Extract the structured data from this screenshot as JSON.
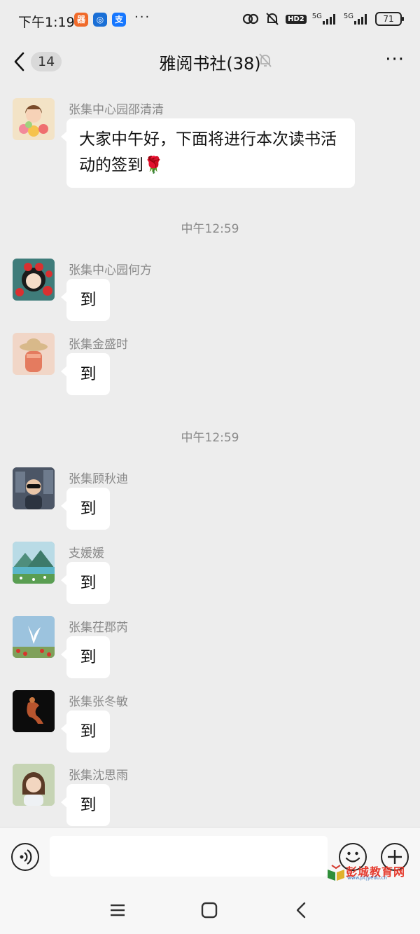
{
  "status_bar": {
    "time": "下午1:19",
    "app_icons": [
      {
        "icon": "orange-app-icon",
        "glyph": "器",
        "color": "#f06a2a"
      },
      {
        "icon": "blue-app-icon",
        "glyph": "◎",
        "color": "#1a6fd6"
      },
      {
        "icon": "alipay-icon",
        "glyph": "支",
        "color": "#1677ff"
      }
    ],
    "more": "···",
    "hd_badge": "HD2",
    "network_1": "5G",
    "network_2": "5G",
    "battery": "71"
  },
  "header": {
    "unread_count": "14",
    "title": "雅阅书社(38)",
    "more_label": "···"
  },
  "messages": [
    {
      "sender": "张集中心园邵清清",
      "text": "大家中午好，下面将进行本次读书活动的签到🌹",
      "avatar": "flowers-girl-avatar",
      "avatar_bg": "#f3e3c6"
    },
    {
      "sender": "张集中心园何方",
      "text": "到",
      "avatar": "red-flower-girl-avatar",
      "avatar_bg": "#3f7c7a"
    },
    {
      "sender": "张集金盛时",
      "text": "到",
      "avatar": "straw-hat-avatar",
      "avatar_bg": "#f1d6c7"
    },
    {
      "sender": "张集顾秋迪",
      "text": "到",
      "avatar": "child-photo-avatar",
      "avatar_bg": "#3a3f48"
    },
    {
      "sender": "支媛媛",
      "text": "到",
      "avatar": "landscape-avatar",
      "avatar_bg": "#6aa5b6"
    },
    {
      "sender": "张集茌郡芮",
      "text": "到",
      "avatar": "dove-avatar",
      "avatar_bg": "#8fb8d6"
    },
    {
      "sender": "张集张冬敏",
      "text": "到",
      "avatar": "dancer-avatar",
      "avatar_bg": "#0c0c0c"
    },
    {
      "sender": "张集沈思雨",
      "text": "到",
      "avatar": "girl-photo-avatar",
      "avatar_bg": "#b9c9a9"
    }
  ],
  "timestamps": [
    "中午12:59",
    "中午12:59"
  ],
  "input": {
    "placeholder": ""
  },
  "watermark": {
    "text": "彭城教育网",
    "url": "www.pcjyedu.cn"
  }
}
